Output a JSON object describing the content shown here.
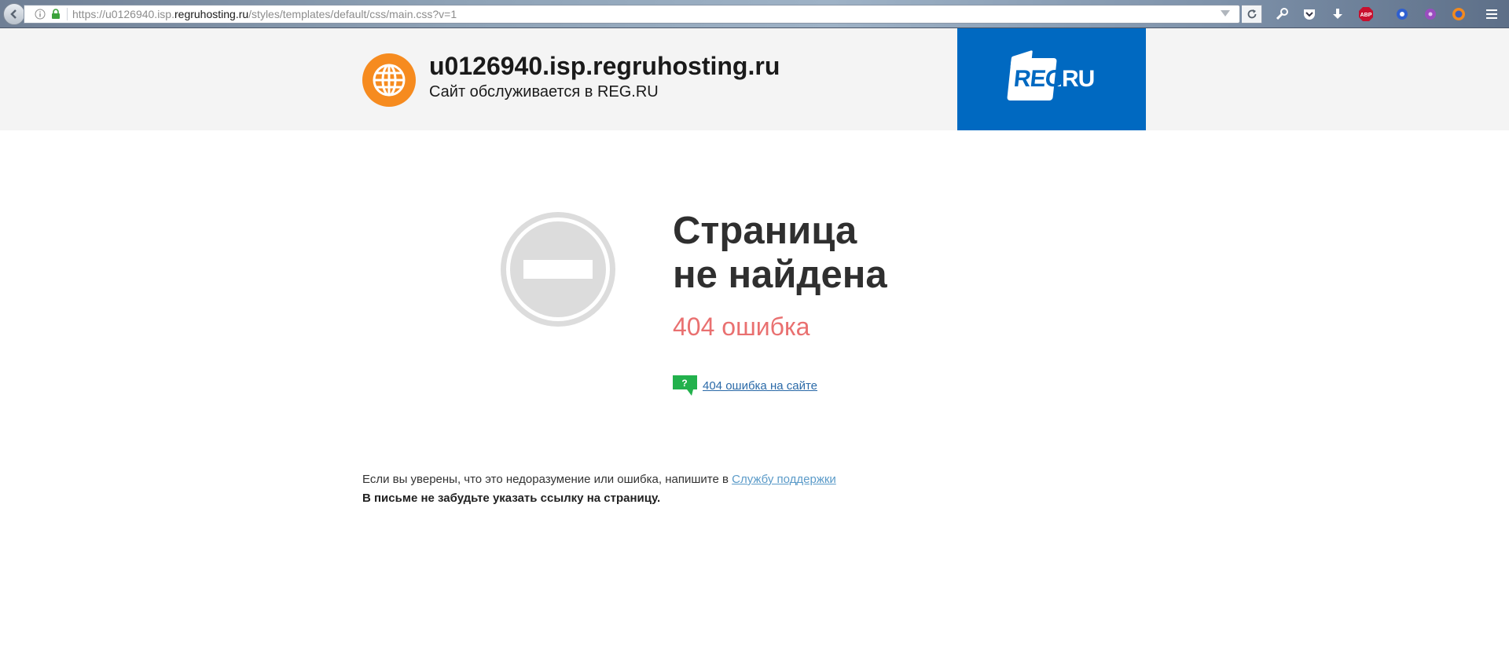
{
  "browser": {
    "url_prefix": "https://u0126940.isp.",
    "url_domain": "regruhosting.ru",
    "url_path": "/styles/templates/default/css/main.css?v=1",
    "toolbar_icons": [
      "back-icon",
      "info-icon",
      "lock-icon",
      "dropdown-icon",
      "reload-icon",
      "wrench-icon",
      "pocket-icon",
      "download-icon",
      "adblock-icon",
      "extension-icon",
      "extension-icon",
      "firefox-icon",
      "menu-icon"
    ],
    "adblock_label": "ABP"
  },
  "header": {
    "site_title": "u0126940.isp.regruhosting.ru",
    "site_subtitle": "Сайт обслуживается в REG.RU",
    "logo_reg": "REG",
    "logo_ru": ".RU",
    "logo_color": "#0069c1",
    "globe_color": "#f68b1f"
  },
  "main": {
    "title_line1": "Страница",
    "title_line2": "не найдена",
    "error_code": "404 ошибка",
    "help_icon_glyph": "?",
    "help_link": "404 ошибка на сайте",
    "support_text": "Если вы уверены, что это недоразумение или ошибка, напишите в ",
    "support_link": "Службу поддержки",
    "support_note": "В письме не забудьте указать ссылку на страницу."
  }
}
